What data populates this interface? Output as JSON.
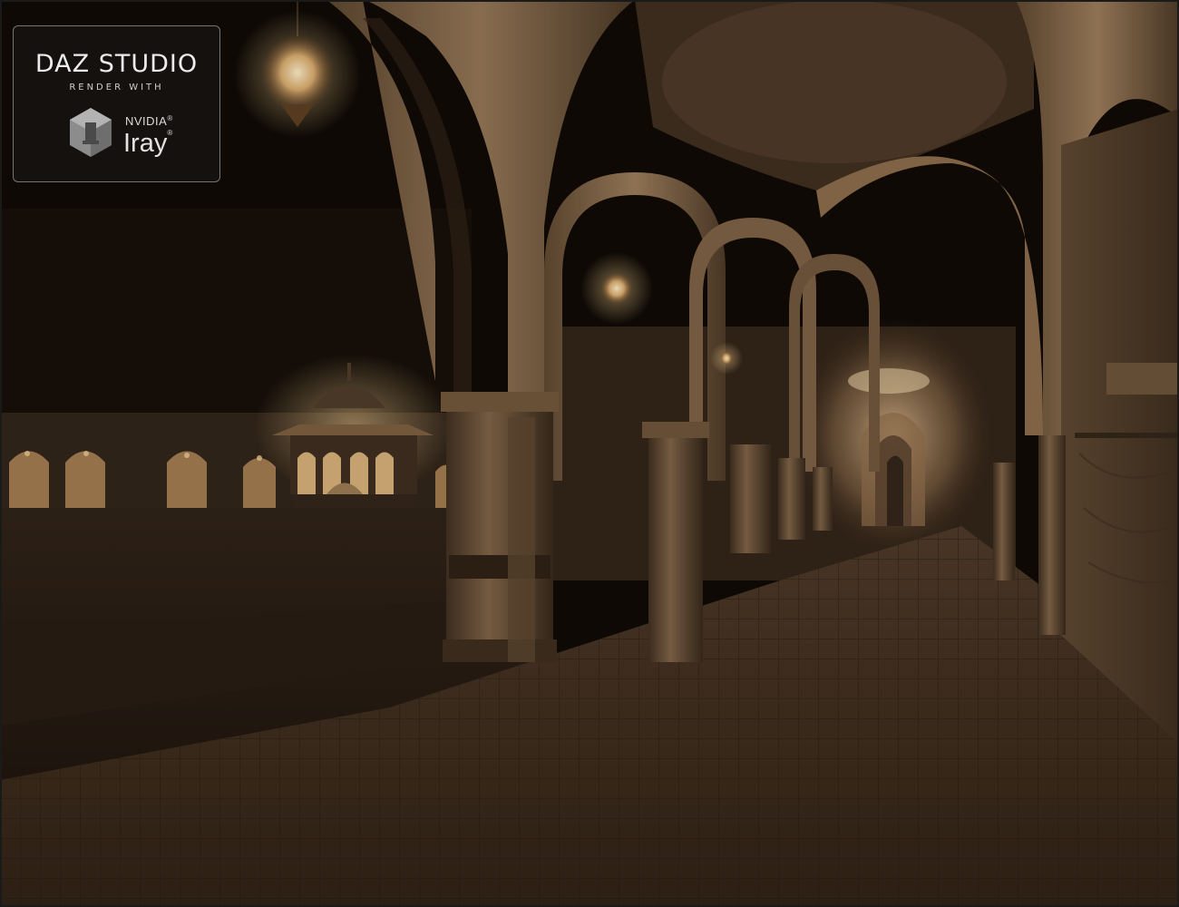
{
  "badge": {
    "brand": "DAZ STUDIO",
    "subtitle": "RENDER WITH",
    "vendor": "NVIDIA",
    "vendor_mark": "®",
    "product": "Iray",
    "product_mark": "®"
  },
  "colors": {
    "sky": "#070403",
    "stone_light": "#8a6f52",
    "stone_mid": "#5a4631",
    "stone_dark": "#2a1e14",
    "floor": "#3a2a1c",
    "lamp_glow": "#f3d7a0"
  }
}
